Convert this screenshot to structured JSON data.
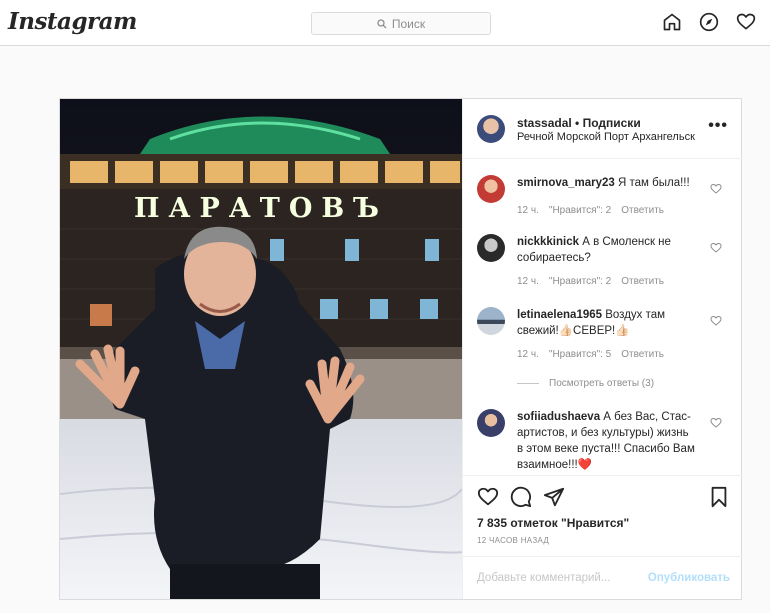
{
  "header": {
    "logo": "Instagram",
    "search_placeholder": "Поиск",
    "icons": [
      "home-icon",
      "explore-icon",
      "activity-heart-icon"
    ]
  },
  "post": {
    "username": "stassadal",
    "follow_label": "Подписки",
    "location": "Речной Морской Порт Архангельск",
    "photo_sign": "ПАРАТОВЪ",
    "comments": [
      {
        "user": "smirnova_mary23",
        "text": "Я там была!!!",
        "time": "12 ч.",
        "likes": "\"Нравится\": 2",
        "reply": "Ответить"
      },
      {
        "user": "nickkkinick",
        "text": "А в Смоленск не собираетесь?",
        "time": "12 ч.",
        "likes": "\"Нравится\": 2",
        "reply": "Ответить"
      },
      {
        "user": "letinaelena1965",
        "text": "Воздух там свежий!👍🏻СЕВЕР!👍🏻",
        "time": "12 ч.",
        "likes": "\"Нравится\": 5",
        "reply": "Ответить"
      },
      {
        "user": "sofiiadushaeva",
        "text": "А без Вас, Стас-артистов, и без культуры) жизнь в этом веке пуста!!! Спасибо Вам взаимное!!!❤️"
      }
    ],
    "view_replies": "Посмотреть ответы (3)",
    "likes_count": "7 835 отметок \"Нравится\"",
    "time_ago": "12 часов назад",
    "comment_placeholder": "Добавьте комментарий...",
    "publish_label": "Опубликовать",
    "colors": {
      "link_blue_disabled": "#b2dffc",
      "heart_red": "#ed4956"
    }
  }
}
